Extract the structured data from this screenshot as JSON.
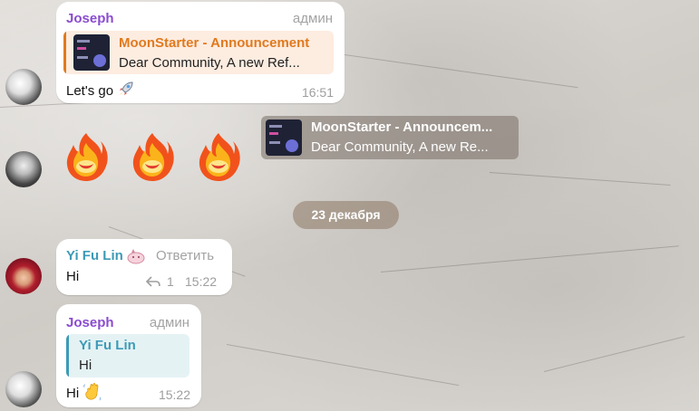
{
  "colors": {
    "admin_name": "#8b4ccf",
    "yifulin_name": "#3d9ab6",
    "announce_title": "#e07a1f",
    "announce_bg": "#fdece0",
    "reply_bg": "#e5f2f4"
  },
  "messages": {
    "m1": {
      "sender": "Joseph",
      "role": "админ",
      "quote_title": "MoonStarter - Announcement",
      "quote_text": "Dear Community,  A new Ref...",
      "text": "Let's go",
      "text_emoji": "rocket-emoji",
      "time": "16:51"
    },
    "m2": {
      "emoji": [
        "fire-emoji",
        "fire-emoji",
        "fire-emoji"
      ],
      "forward_title": "MoonStarter - Announcem...",
      "forward_text": "Dear Community,  A new Re..."
    },
    "date_separator": "23 декабря",
    "m3": {
      "sender": "Yi Fu Lin",
      "reply_label": "Ответить",
      "text": "Hi",
      "reply_count": "1",
      "time": "15:22"
    },
    "m4": {
      "sender": "Joseph",
      "role": "админ",
      "quote_title": "Yi Fu Lin",
      "quote_text": "Hi",
      "text": "Hi",
      "text_emoji": "waving-hand-emoji",
      "time": "15:22"
    }
  }
}
